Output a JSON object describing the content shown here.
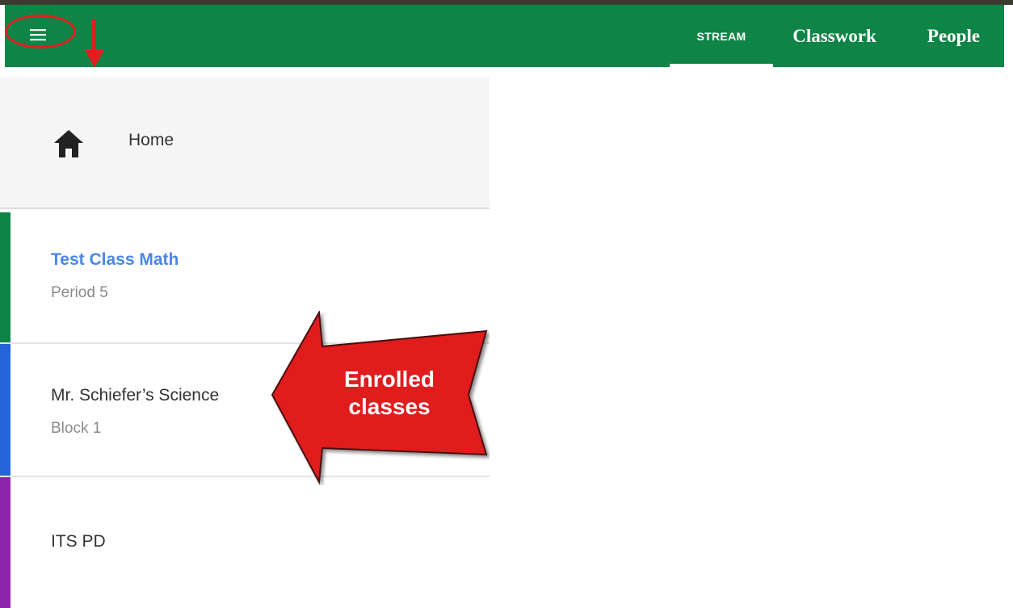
{
  "header": {
    "tabs": [
      {
        "label": "STREAM",
        "active": true
      },
      {
        "label": "Classwork"
      },
      {
        "label": "People"
      }
    ],
    "colors": {
      "app_bar": "#0e8447",
      "callout": "#e01e1e"
    }
  },
  "icons": {
    "menu": "hamburger-menu-icon",
    "home": "home-icon"
  },
  "drawer": {
    "home_label": "Home",
    "classes": [
      {
        "name": "Test Class Math",
        "section": "Period 5",
        "color": "#0e8447"
      },
      {
        "name": "Mr. Schiefer’s Science",
        "section": "Block 1",
        "color": "#2563d9"
      },
      {
        "name": "ITS PD",
        "section": "",
        "color": "#8e24aa"
      }
    ]
  },
  "annotation": {
    "line1": "Enrolled",
    "line2": "classes"
  }
}
